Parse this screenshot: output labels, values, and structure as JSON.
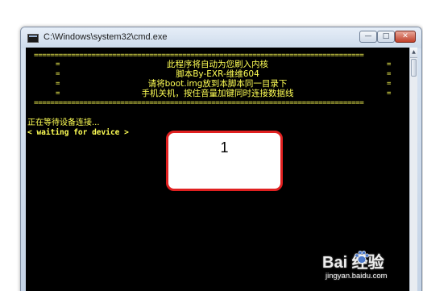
{
  "window": {
    "title": "C:\\Windows\\system32\\cmd.exe",
    "minimize_glyph": "—",
    "maximize_glyph": "□",
    "close_glyph": "✕"
  },
  "console": {
    "rule": "================================================================================",
    "side_marker": "=",
    "lines": [
      "此程序将自动为您刷入内核",
      "脚本By-EXR-维维604",
      "请将boot.img放到本脚本同一目录下",
      "手机关机，按住音量加键同时连接数据线"
    ],
    "status": "正在等待设备连接...",
    "waiting": "< waiting for device >"
  },
  "callout": {
    "number": "1"
  },
  "watermark": {
    "brand": "Bai  经验",
    "url": "jingyan.baidu.com"
  },
  "colors": {
    "console_bg": "#000000",
    "console_text": "#ffff55",
    "callout_border": "#e02020"
  }
}
